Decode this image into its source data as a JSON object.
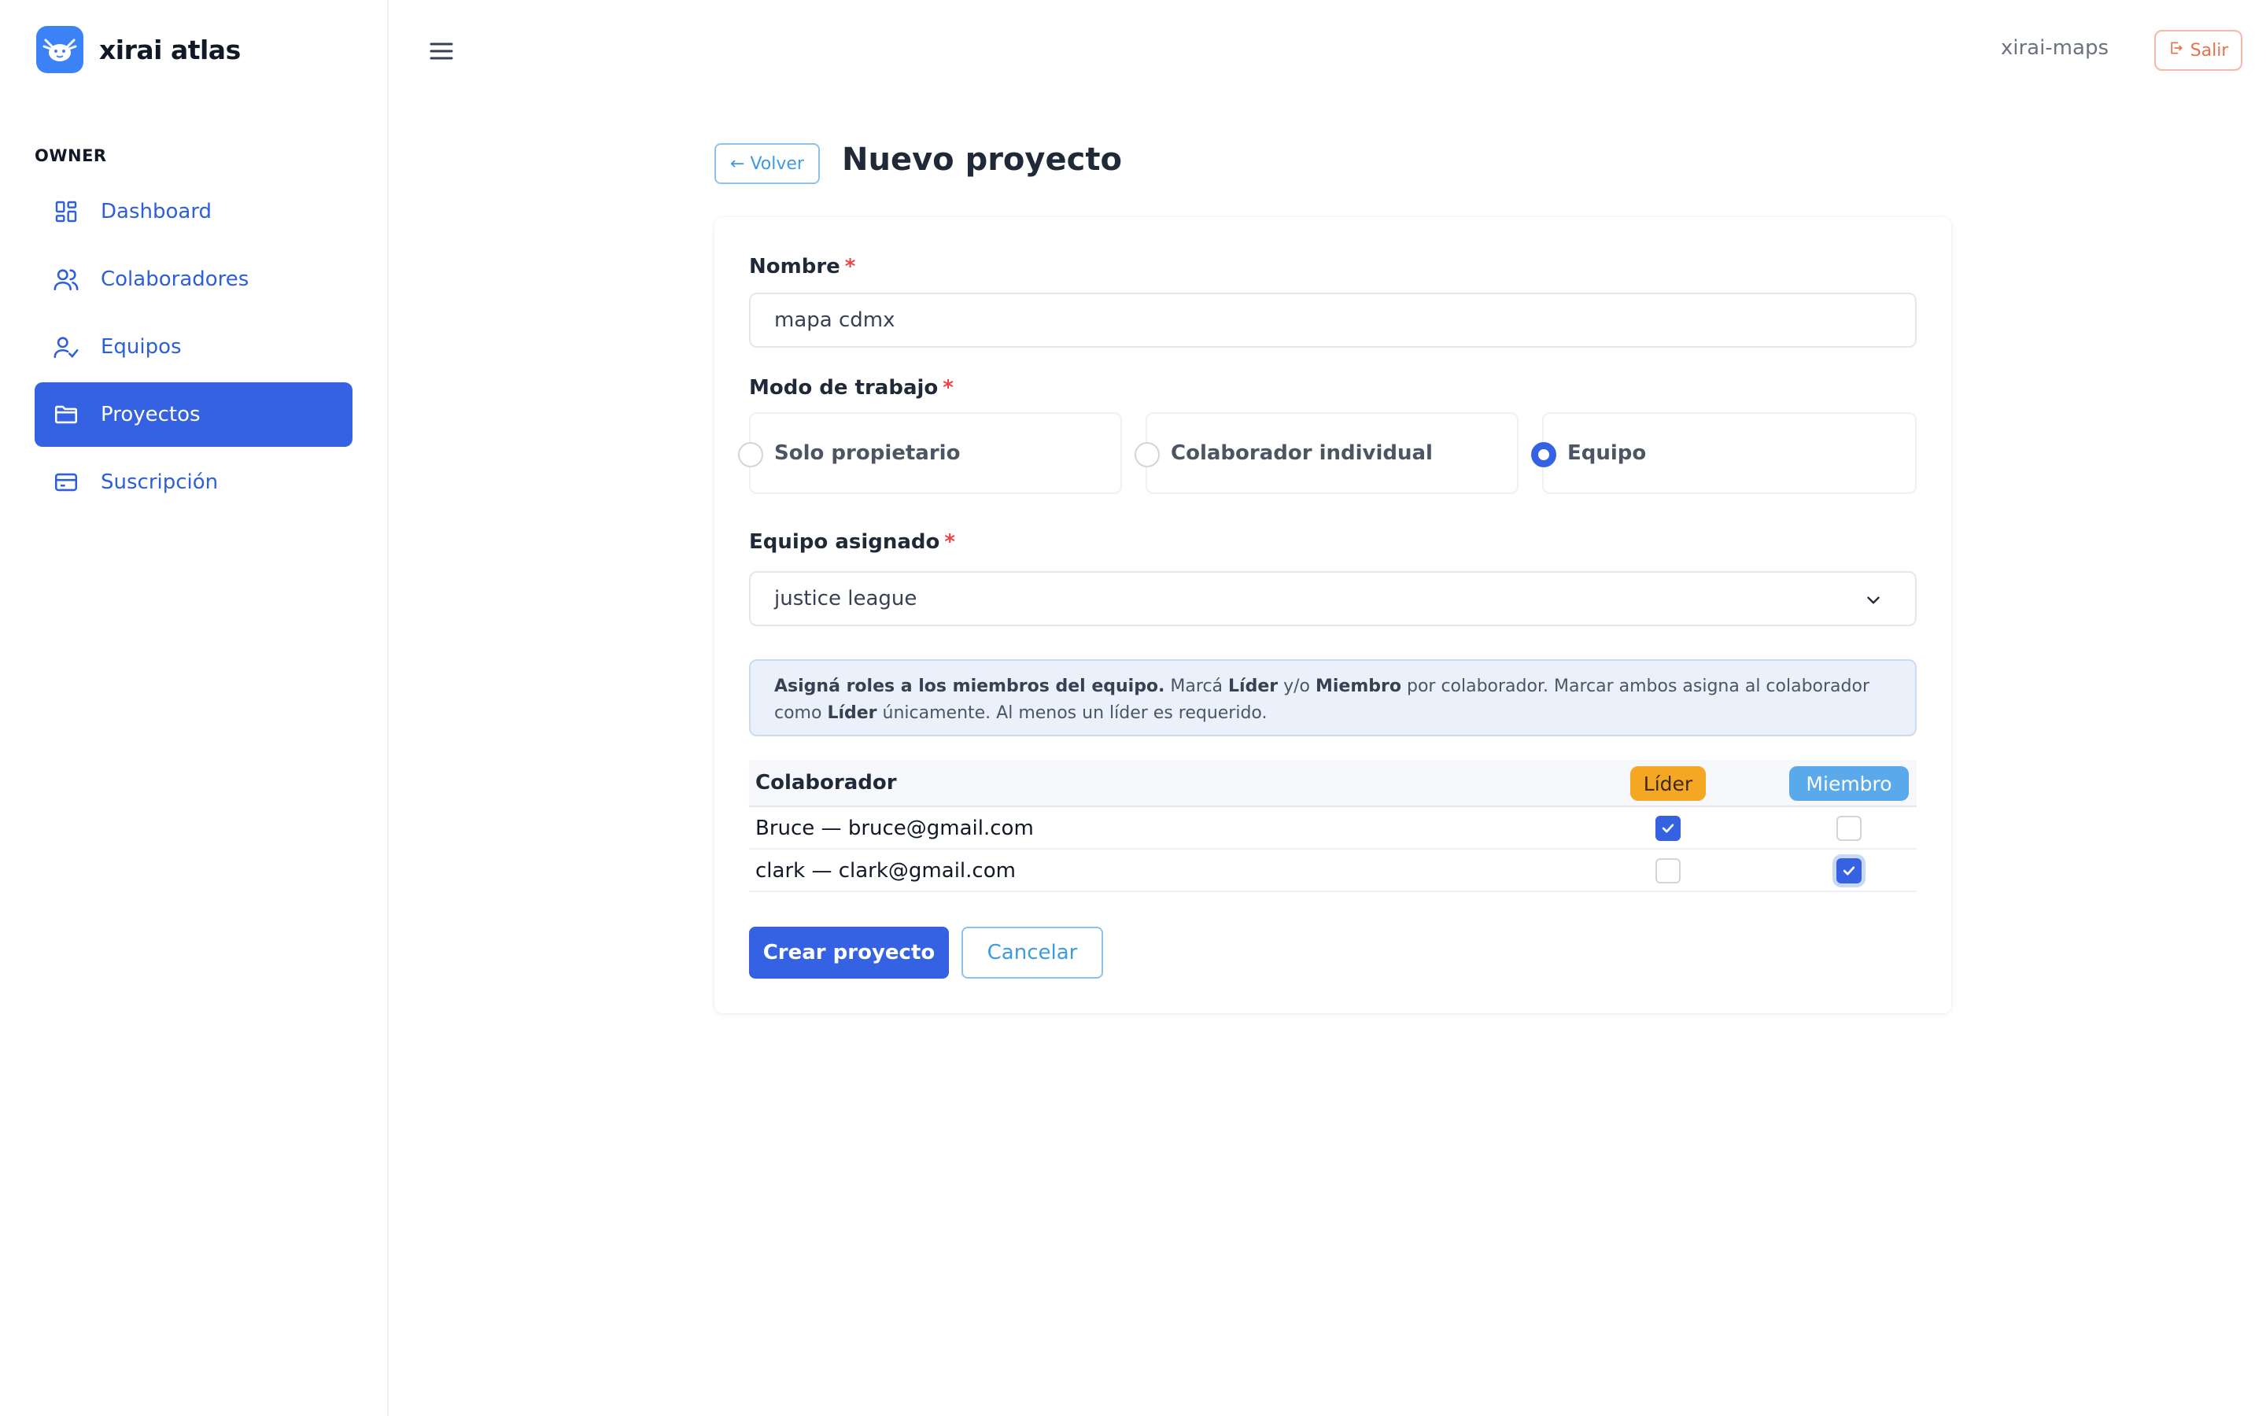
{
  "brand": {
    "name": "xirai atlas",
    "logo_icon": "axolotl-icon",
    "logo_color": "#3b82f6"
  },
  "sidebar": {
    "section_label": "OWNER",
    "items": [
      {
        "label": "Dashboard",
        "icon": "dashboard-icon",
        "active": false
      },
      {
        "label": "Colaboradores",
        "icon": "users-icon",
        "active": false
      },
      {
        "label": "Equipos",
        "icon": "user-check-icon",
        "active": false
      },
      {
        "label": "Proyectos",
        "icon": "folder-icon",
        "active": true
      },
      {
        "label": "Suscripción",
        "icon": "credit-card-icon",
        "active": false
      }
    ]
  },
  "header": {
    "menu_icon": "hamburger-icon",
    "org_name": "xirai-maps",
    "logout_label": "Salir",
    "logout_icon": "logout-icon"
  },
  "page": {
    "back_label": "← Volver",
    "title": "Nuevo proyecto"
  },
  "form": {
    "name": {
      "label": "Nombre",
      "required_mark": "*",
      "value": "mapa cdmx"
    },
    "work_mode": {
      "label": "Modo de trabajo",
      "required_mark": "*",
      "options": [
        {
          "label": "Solo propietario",
          "checked": false
        },
        {
          "label": "Colaborador individual",
          "checked": false
        },
        {
          "label": "Equipo",
          "checked": true
        }
      ]
    },
    "team": {
      "label": "Equipo asignado",
      "required_mark": "*",
      "value": "justice league"
    },
    "info": {
      "strong1": "Asigná roles a los miembros del equipo.",
      "t1": " Marcá ",
      "strong2": "Líder",
      "t2": " y/o ",
      "strong3": "Miembro",
      "t3": " por colaborador. Marcar ambos asigna al colaborador como ",
      "strong4": "Líder",
      "t4": " únicamente. Al menos un líder es requerido."
    },
    "roles_table": {
      "col_collaborator": "Colaborador",
      "col_leader": "Líder",
      "col_member": "Miembro",
      "rows": [
        {
          "name": "Bruce — bruce@gmail.com",
          "leader": true,
          "member": false
        },
        {
          "name": "clark — clark@gmail.com",
          "leader": false,
          "member": true
        }
      ]
    },
    "submit_label": "Crear proyecto",
    "cancel_label": "Cancelar"
  },
  "colors": {
    "primary": "#3562e3",
    "leader_badge": "#f5a623",
    "member_badge": "#5aa9ea",
    "danger": "#e9724c"
  }
}
